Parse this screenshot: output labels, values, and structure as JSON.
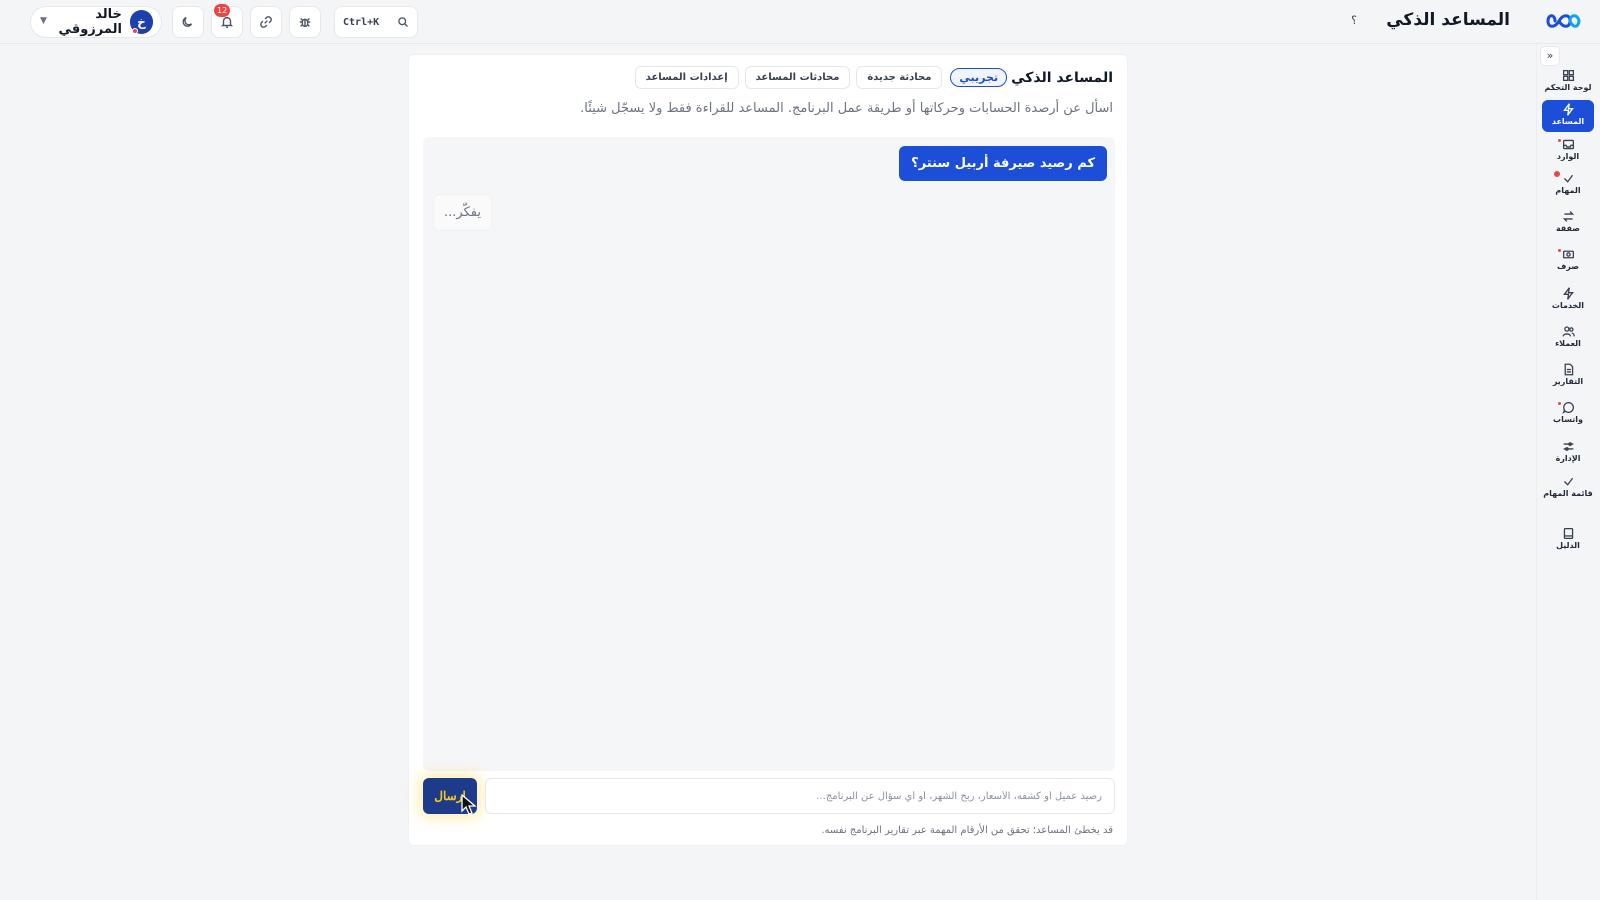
{
  "header": {
    "app_title": "المساعد الذكي",
    "help_label": "؟",
    "search_shortcut": "Ctrl+K",
    "notifications_count": "12",
    "user": {
      "name": "خالد المرزوقي",
      "avatar_initial": "خ"
    }
  },
  "sidebar": {
    "collapse_label": "»",
    "items": [
      {
        "label": "لوحة التحكم",
        "icon": "dashboard-icon"
      },
      {
        "label": "المساعد",
        "icon": "bolt-icon",
        "active": true
      },
      {
        "label": "الوارد",
        "icon": "inbox-icon"
      },
      {
        "label": "المهام",
        "icon": "check-icon"
      },
      {
        "label": "صفقة",
        "icon": "exchange-icon"
      },
      {
        "label": "صرف",
        "icon": "cash-icon"
      },
      {
        "label": "الخدمات",
        "icon": "bolt-icon"
      },
      {
        "label": "العملاء",
        "icon": "users-icon"
      },
      {
        "label": "التقارير",
        "icon": "report-icon"
      },
      {
        "label": "واتساب",
        "icon": "chat-icon"
      },
      {
        "label": "الإدارة",
        "icon": "sliders-icon"
      },
      {
        "label": "قائمة المهام",
        "icon": "check-icon"
      },
      {
        "label": "الدليل",
        "icon": "book-icon"
      }
    ]
  },
  "assistant": {
    "title": "المساعد الذكي",
    "badge": "تجريبي",
    "new_chat_label": "محادثة جديدة",
    "chats_label": "محادثات المساعد",
    "settings_label": "إعدادات المساعد",
    "description": "اسأل عن أرصدة الحسابات وحركاتها أو طريقة عمل البرنامج. المساعد للقراءة فقط ولا يسجّل شيئًا.",
    "messages": {
      "user": "كم رصيد صيرفة أربيل سنتر؟",
      "thinking": "يفكّر..."
    },
    "input_placeholder": "رصيد عميل أو كشفه، الأسعار، ربح الشهر، أو أي سؤال عن البرنامج...",
    "send_label": "إرسال",
    "disclaimer": "قد يخطئ المساعد؛ تحقق من الأرقام المهمة عبر تقارير البرنامج نفسه."
  }
}
